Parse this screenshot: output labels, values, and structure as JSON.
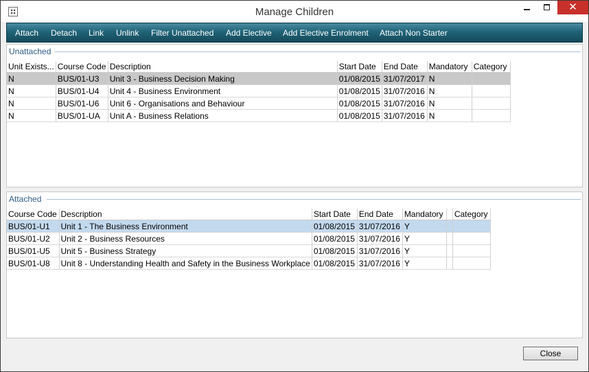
{
  "window": {
    "title": "Manage Children",
    "close_glyph": "✕"
  },
  "toolbar": {
    "buttons": [
      "Attach",
      "Detach",
      "Link",
      "Unlink",
      "Filter Unattached",
      "Add Elective",
      "Add Elective Enrolment",
      "Attach Non Starter"
    ]
  },
  "unattached": {
    "title": "Unattached",
    "columns": [
      "Unit Exists...",
      "Course Code",
      "Description",
      "Start Date",
      "End Date",
      "Mandatory",
      "Category"
    ],
    "rows": [
      [
        "N",
        "BUS/01-U3",
        "Unit 3 - Business Decision Making",
        "01/08/2015",
        "31/07/2017",
        "N",
        ""
      ],
      [
        "N",
        "BUS/01-U4",
        "Unit 4 - Business Environment",
        "01/08/2015",
        "31/07/2016",
        "N",
        ""
      ],
      [
        "N",
        "BUS/01-U6",
        "Unit 6 - Organisations and Behaviour",
        "01/08/2015",
        "31/07/2016",
        "N",
        ""
      ],
      [
        "N",
        "BUS/01-UA",
        "Unit A - Business Relations",
        "01/08/2015",
        "31/07/2016",
        "N",
        ""
      ]
    ]
  },
  "attached": {
    "title": "Attached",
    "columns": [
      "Course Code",
      "Description",
      "Start Date",
      "End Date",
      "Mandatory",
      "",
      "Category"
    ],
    "rows": [
      [
        "BUS/01-U1",
        "Unit 1 - The Business Environment",
        "01/08/2015",
        "31/07/2016",
        "Y",
        "",
        ""
      ],
      [
        "BUS/01-U2",
        "Unit 2 - Business Resources",
        "01/08/2015",
        "31/07/2016",
        "Y",
        "",
        ""
      ],
      [
        "BUS/01-U5",
        "Unit 5 - Business Strategy",
        "01/08/2015",
        "31/07/2016",
        "Y",
        "",
        ""
      ],
      [
        "BUS/01-U8",
        "Unit 8 - Understanding Health and Safety in the Business Workplace",
        "01/08/2015",
        "31/07/2016",
        "Y",
        "",
        ""
      ]
    ]
  },
  "footer": {
    "close_label": "Close"
  },
  "colors": {
    "toolbar": "#206478",
    "selected_unattached": "#c8c8c8",
    "selected_attached": "#c3d9ee",
    "close_button": "#c7302b"
  }
}
